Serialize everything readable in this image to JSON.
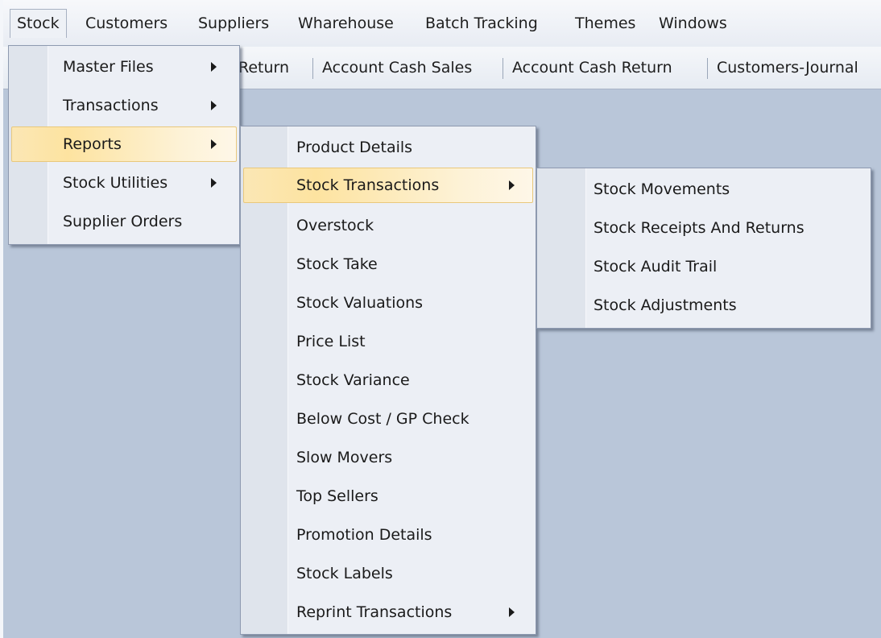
{
  "menubar": {
    "items": [
      "Stock",
      "Customers",
      "Suppliers",
      "Wharehouse",
      "Batch Tracking",
      "Themes",
      "Windows"
    ]
  },
  "toolbar": {
    "items": [
      "Return",
      "Account Cash Sales",
      "Account Cash Return",
      "Customers-Journal"
    ]
  },
  "stock_menu": {
    "items": [
      {
        "label": "Master Files",
        "has_submenu": true
      },
      {
        "label": "Transactions",
        "has_submenu": true
      },
      {
        "label": "Reports",
        "has_submenu": true,
        "highlighted": true
      },
      {
        "label": "Stock Utilities",
        "has_submenu": true
      },
      {
        "label": "Supplier Orders",
        "has_submenu": false
      }
    ]
  },
  "reports_menu": {
    "items": [
      {
        "label": "Product Details",
        "has_submenu": false
      },
      {
        "label": "Stock Transactions",
        "has_submenu": true,
        "highlighted": true
      },
      {
        "label": "Overstock",
        "has_submenu": false
      },
      {
        "label": "Stock Take",
        "has_submenu": false
      },
      {
        "label": "Stock Valuations",
        "has_submenu": false
      },
      {
        "label": "Price List",
        "has_submenu": false
      },
      {
        "label": "Stock Variance",
        "has_submenu": false
      },
      {
        "label": "Below Cost / GP Check",
        "has_submenu": false
      },
      {
        "label": "Slow Movers",
        "has_submenu": false
      },
      {
        "label": "Top Sellers",
        "has_submenu": false
      },
      {
        "label": "Promotion Details",
        "has_submenu": false
      },
      {
        "label": "Stock Labels",
        "has_submenu": false
      },
      {
        "label": "Reprint Transactions",
        "has_submenu": true
      }
    ]
  },
  "stock_transactions_menu": {
    "items": [
      {
        "label": "Stock Movements"
      },
      {
        "label": "Stock Receipts And Returns"
      },
      {
        "label": "Stock Audit Trail"
      },
      {
        "label": "Stock Adjustments"
      }
    ]
  },
  "colors": {
    "workspace": "#b9c6d9",
    "menu_background": "#eceff5",
    "highlight": "#fde3a0",
    "highlight_border": "#e9c87c"
  }
}
